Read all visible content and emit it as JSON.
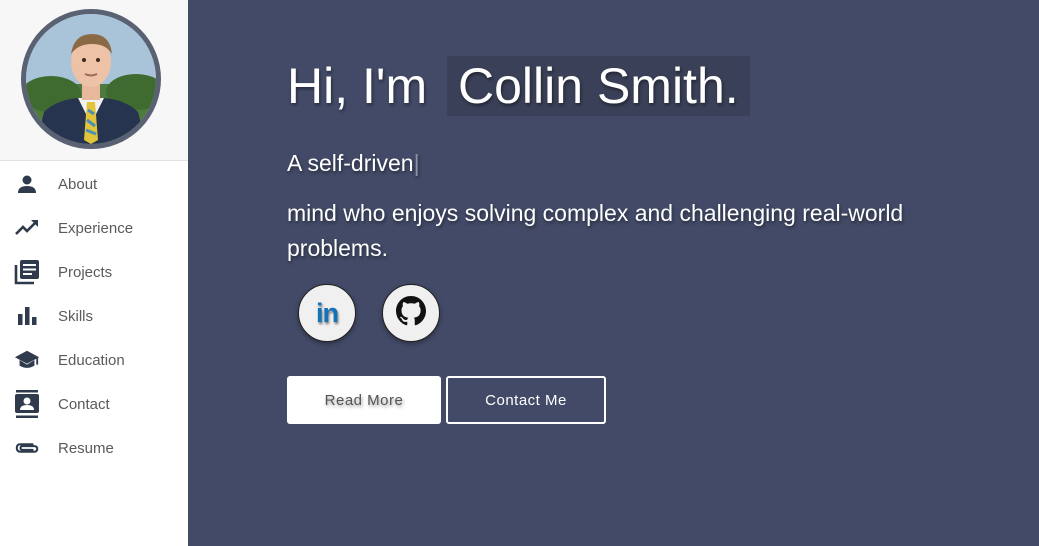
{
  "sidebar": {
    "avatar_alt": "Collin Smith",
    "items": [
      {
        "label": "About",
        "icon": "person-icon"
      },
      {
        "label": "Experience",
        "icon": "trending-up-icon"
      },
      {
        "label": "Projects",
        "icon": "library-books-icon"
      },
      {
        "label": "Skills",
        "icon": "bar-chart-icon"
      },
      {
        "label": "Education",
        "icon": "school-icon"
      },
      {
        "label": "Contact",
        "icon": "contacts-icon"
      },
      {
        "label": "Resume",
        "icon": "paperclip-icon"
      }
    ]
  },
  "hero": {
    "greeting": "Hi, I'm",
    "name": "Collin Smith.",
    "typed_text": "A self-driven",
    "typed_cursor": "|",
    "description": "mind who enjoys solving complex and challenging real-world problems.",
    "social": {
      "linkedin_label": "in",
      "linkedin_icon": "linkedin-icon",
      "github_icon": "github-icon"
    },
    "buttons": {
      "read_more": "Read More",
      "contact_me": "Contact Me"
    }
  },
  "colors": {
    "main_bg": "#424a67",
    "sidebar_bg": "#ffffff",
    "icon_color": "#2f3b4c",
    "linkedin_blue": "#1472b8"
  }
}
